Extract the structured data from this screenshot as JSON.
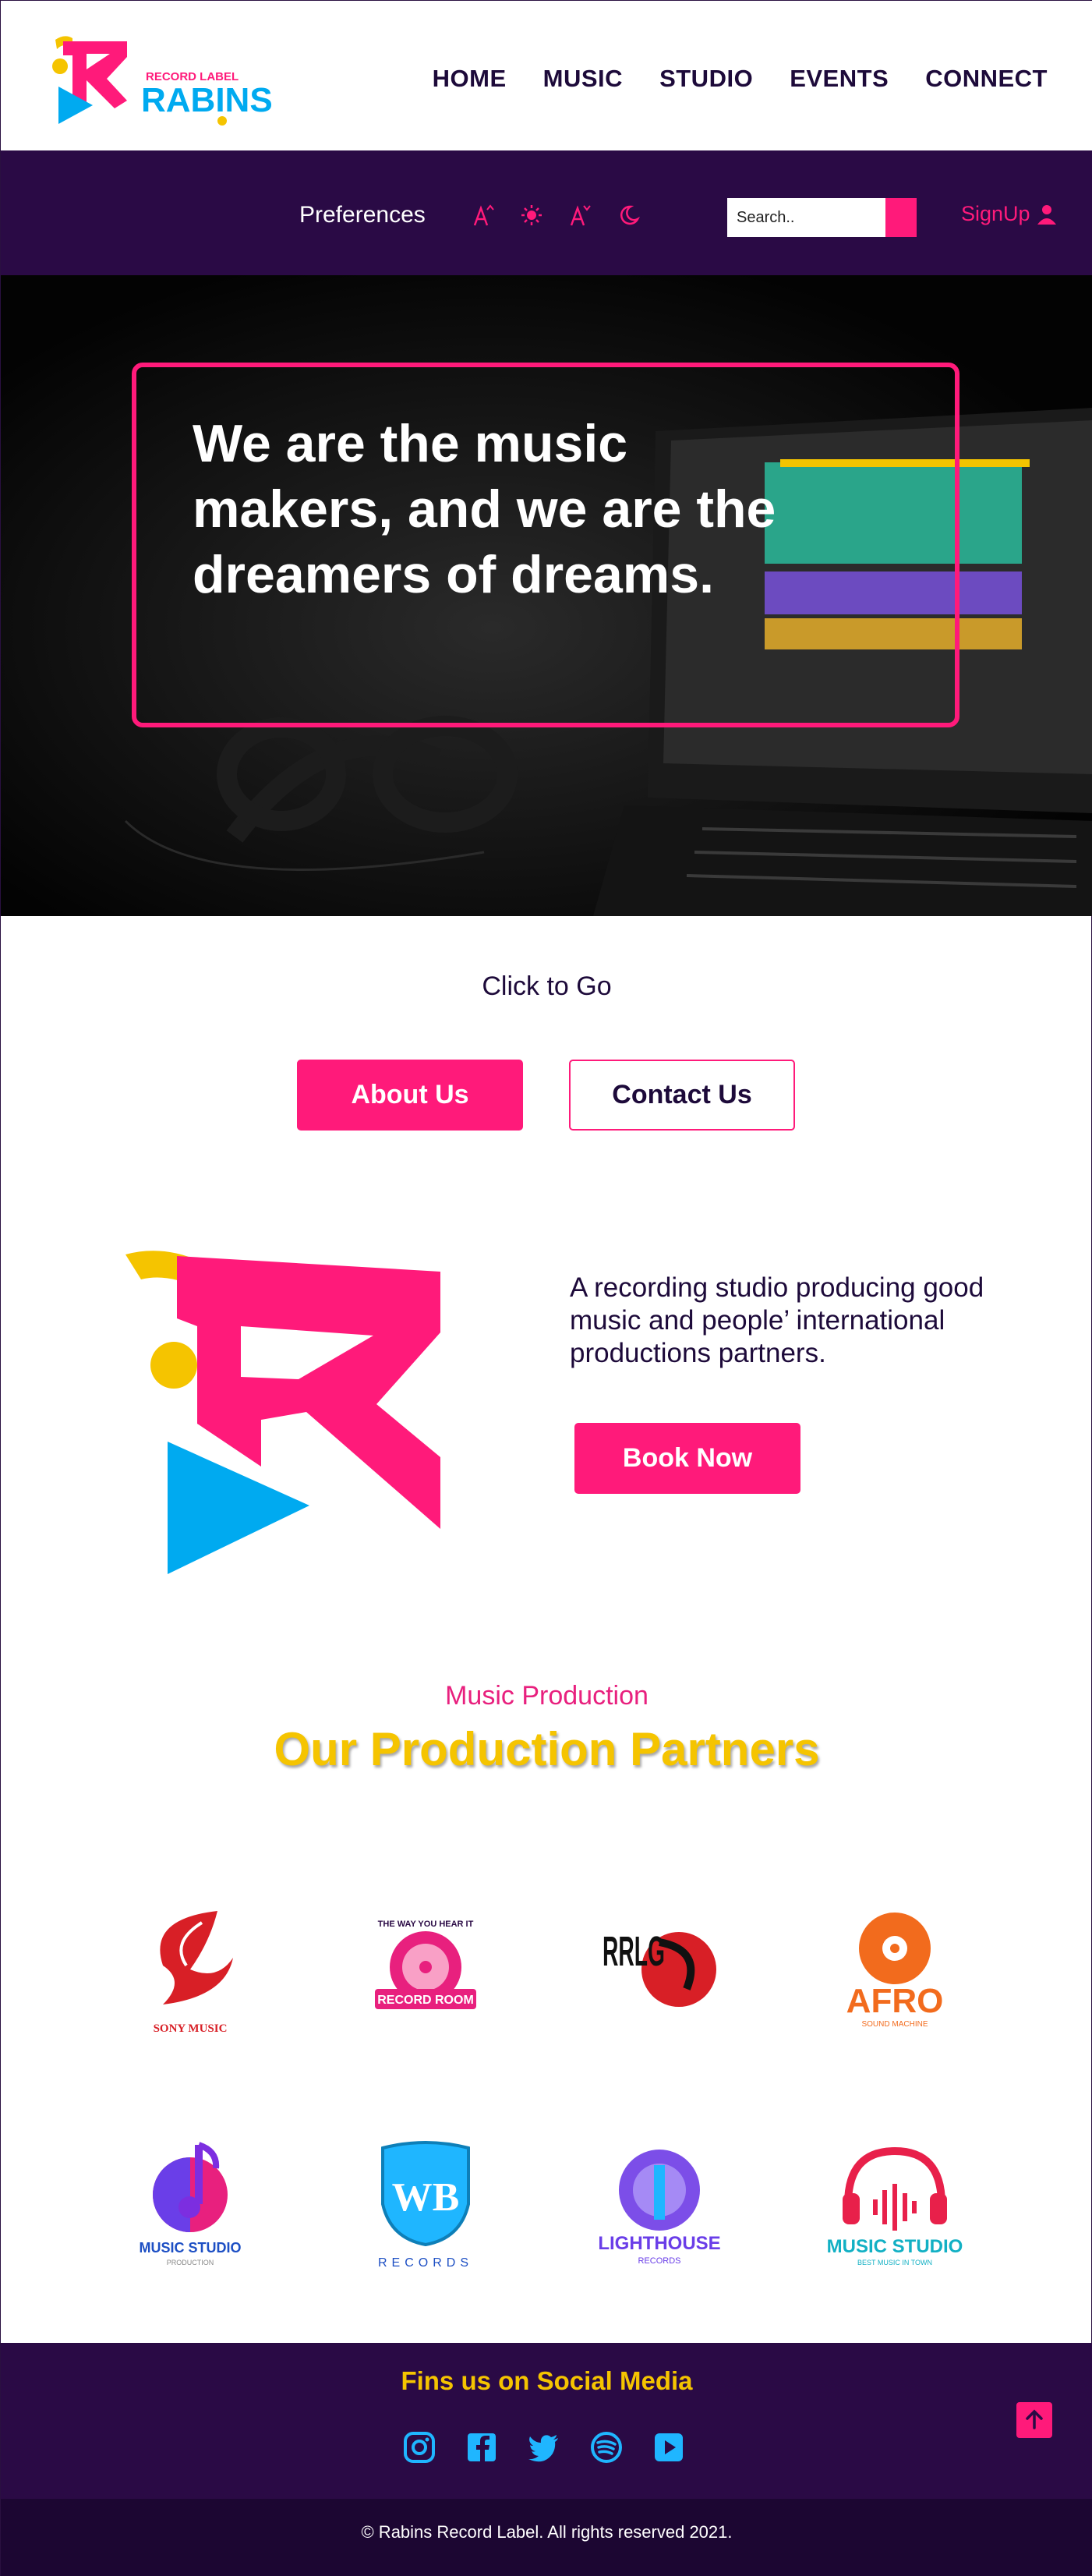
{
  "brand": {
    "logo_small_text": "RECORD LABEL",
    "logo_name": "RABINS"
  },
  "nav": {
    "items": [
      {
        "label": "HOME"
      },
      {
        "label": "MUSIC"
      },
      {
        "label": "STUDIO"
      },
      {
        "label": "EVENTS"
      },
      {
        "label": "CONNECT"
      }
    ]
  },
  "preferences": {
    "label": "Preferences",
    "icons": [
      "increase-font-icon",
      "brightness-icon",
      "decrease-font-icon",
      "dark-mode-icon"
    ],
    "search_placeholder": "Search..",
    "signup_label": "SignUp"
  },
  "hero": {
    "headline": "We are the music makers, and we are the dreamers of dreams."
  },
  "click_to_go": {
    "title": "Click to Go",
    "about_label": "About Us",
    "contact_label": "Contact Us"
  },
  "about": {
    "description": "A recording studio producing good music and people’ international productions partners.",
    "book_label": "Book Now"
  },
  "partners": {
    "subtitle": "Music Production",
    "title": "Our Production Partners",
    "logos": [
      {
        "name": "SONY MUSIC"
      },
      {
        "name": "RECORD ROOM",
        "top_text": "THE WAY YOU HEAR IT"
      },
      {
        "name": "RRLG"
      },
      {
        "name": "AFRO",
        "sub": "SOUND MACHINE"
      },
      {
        "name": "MUSIC STUDIO",
        "sub": "PRODUCTION"
      },
      {
        "name": "WB",
        "sub": "RECORDS"
      },
      {
        "name": "LIGHTHOUSE",
        "sub": "RECORDS"
      },
      {
        "name": "MUSIC STUDIO",
        "sub": "BEST MUSIC IN TOWN"
      }
    ]
  },
  "social": {
    "title": "Fins us on Social Media",
    "icons": [
      "instagram-icon",
      "facebook-icon",
      "twitter-icon",
      "spotify-icon",
      "youtube-icon"
    ]
  },
  "footer": {
    "copyright": "© Rabins Record Label. All rights reserved 2021."
  },
  "colors": {
    "primary": "#ff1a7a",
    "dark": "#2a0a45",
    "accent": "#f5c400",
    "blue": "#00aaf0"
  }
}
